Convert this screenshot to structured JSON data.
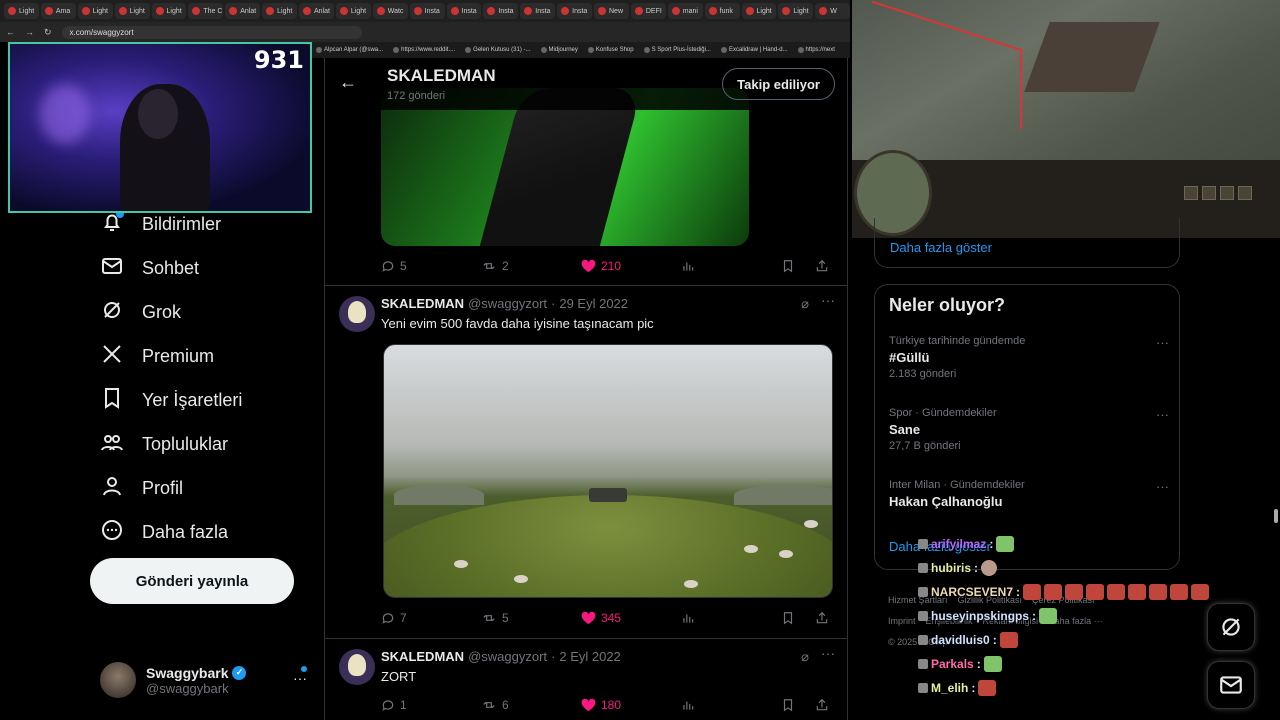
{
  "browser": {
    "tabs": [
      "Light",
      "Ama",
      "Light",
      "Light",
      "Light",
      "The C",
      "Anlat",
      "Light",
      "Anlat",
      "Light",
      "Watc",
      "Insta",
      "Insta",
      "Insta",
      "Insta",
      "Insta",
      "New",
      "DEFI",
      "mani",
      "funk",
      "Light",
      "Light",
      "W"
    ],
    "url": "x.com/swaggyzort",
    "bookmarks": [
      "Alpcan Alpar (@swa...",
      "https://www.reddit....",
      "Gelen Kutusu (31) -...",
      "Midjourney",
      "Konfuse Shop",
      "S Sport Plus-İstediği...",
      "Excalidraw | Hand-d...",
      "https://next"
    ]
  },
  "stream": {
    "viewer_count": "931"
  },
  "nav": {
    "items": [
      {
        "label": "Bildirimler",
        "icon": "bell-icon"
      },
      {
        "label": "Sohbet",
        "icon": "mail-icon"
      },
      {
        "label": "Grok",
        "icon": "grok-icon"
      },
      {
        "label": "Premium",
        "icon": "x-logo-icon"
      },
      {
        "label": "Yer İşaretleri",
        "icon": "bookmark-icon"
      },
      {
        "label": "Topluluklar",
        "icon": "communities-icon"
      },
      {
        "label": "Profil",
        "icon": "profile-icon"
      },
      {
        "label": "Daha fazla",
        "icon": "more-circle-icon"
      }
    ],
    "post_button": "Gönderi yayınla",
    "account": {
      "name": "Swaggybark",
      "handle": "@swaggybark"
    }
  },
  "profile": {
    "name": "SKALEDMAN",
    "post_count": "172 gönderi",
    "follow_label": "Takip ediliyor"
  },
  "posts": [
    {
      "replies": "5",
      "reposts": "2",
      "likes": "210"
    },
    {
      "author": "SKALEDMAN",
      "handle": "@swaggyzort",
      "date": "29 Eyl 2022",
      "text": "Yeni evim 500 favda daha iyisine taşınacam pic",
      "replies": "7",
      "reposts": "5",
      "likes": "345"
    },
    {
      "author": "SKALEDMAN",
      "handle": "@swaggyzort",
      "date": "2 Eyl 2022",
      "text": "ZORT",
      "replies": "1",
      "reposts": "6",
      "likes": "180"
    }
  ],
  "sidebar": {
    "show_more": "Daha fazla göster",
    "trends_title": "Neler oluyor?",
    "trends": [
      {
        "context": "Türkiye tarihinde gündemde",
        "name": "#Güllü",
        "count": "2.183 gönderi"
      },
      {
        "context": "Spor · Gündemdekiler",
        "name": "Sane",
        "count": "27,7 B gönderi"
      },
      {
        "context": "Inter Milan · Gündemdekiler",
        "name": "Hakan Çalhanoğlu",
        "count": ""
      }
    ],
    "trends_more": "Daha fazla göster",
    "footer": [
      "Hizmet Şartları",
      "Gizlilik Politikası",
      "Çerez Politikası",
      "Imprint",
      "Erişilebilirlik",
      "Reklam bilgisi",
      "Daha fazla ···",
      "© 2025 X Corp."
    ]
  },
  "chat": [
    {
      "user": "arifyilmaz",
      "color": "#b46bff"
    },
    {
      "user": "hubiris",
      "color": "#e8f0a0"
    },
    {
      "user": "NARCSEVEN7",
      "color": "#f0d9b0"
    },
    {
      "user": "huseyinpskingps",
      "color": "#cfe3ff"
    },
    {
      "user": "davidluis0",
      "color": "#cfe3ff"
    },
    {
      "user": "Parkals",
      "color": "#ff6aa8"
    },
    {
      "user": "M_elih",
      "color": "#e8f0a0"
    }
  ]
}
